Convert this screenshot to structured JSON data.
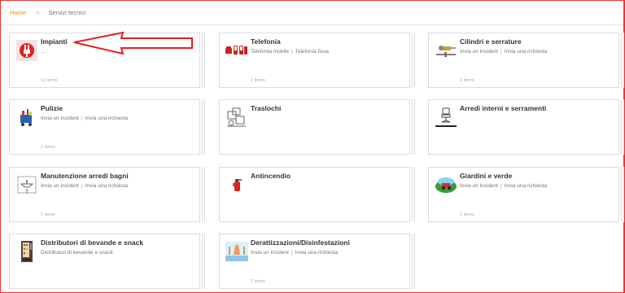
{
  "breadcrumb": {
    "home": "Home",
    "separator": ">",
    "current": "Servizi tecnici"
  },
  "cards": [
    {
      "title": "Impianti",
      "links": [
        "..."
      ],
      "count": "11 items",
      "icon": "electrical-plug-icon"
    },
    {
      "title": "Telefonia",
      "links": [
        "Telefonia mobile",
        "Telefonia fissa"
      ],
      "count": "2 items",
      "icon": "telephone-icon"
    },
    {
      "title": "Cilindri e serrature",
      "links": [
        "Invia un incident",
        "Invia una richiesta"
      ],
      "count": "2 items",
      "icon": "key-lock-icon"
    },
    {
      "title": "Pulizie",
      "links": [
        "Invia un incident",
        "Invia una richiesta"
      ],
      "count": "2 items",
      "icon": "cleaning-cart-icon"
    },
    {
      "title": "Traslochi",
      "links": [],
      "count": "",
      "icon": "moving-boxes-icon"
    },
    {
      "title": "Arredi interni e serramenti",
      "links": [],
      "count": "",
      "icon": "office-chair-icon"
    },
    {
      "title": "Manutenzione arredi bagni",
      "links": [
        "Invia un incident",
        "Invia una richiesta"
      ],
      "count": "2 items",
      "icon": "bathroom-sink-icon"
    },
    {
      "title": "Antincendio",
      "links": [],
      "count": "",
      "icon": "fire-extinguisher-icon"
    },
    {
      "title": "Giardini e verde",
      "links": [
        "Invia un incident",
        "Invia una richiesta"
      ],
      "count": "2 items",
      "icon": "garden-mower-icon"
    },
    {
      "title": "Distributori di bevande e snack",
      "links": [
        "Distributori di bevande e snack"
      ],
      "count": "",
      "icon": "vending-machine-icon"
    },
    {
      "title": "Derattizzazioni/Disinfestazioni",
      "links": [
        "Invia un incident",
        "Invia una richiesta"
      ],
      "count": "2 items",
      "icon": "pest-control-icon"
    }
  ],
  "colors": {
    "accent": "#f08a00",
    "annotation_arrow": "#e02020",
    "frame": "#e33333"
  }
}
